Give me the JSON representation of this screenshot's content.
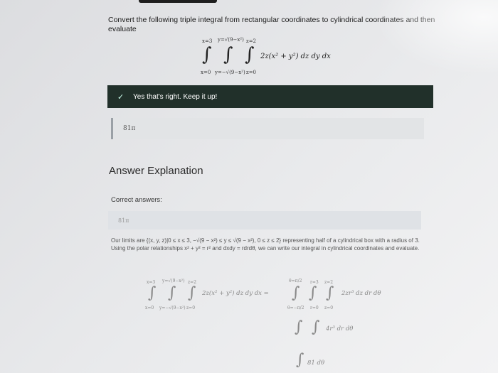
{
  "prompt": "Convert the following triple integral from rectangular coordinates to cylindrical coordinates and then evaluate",
  "question_integral": {
    "x_lower": "x=0",
    "x_upper": "x=3",
    "y_lower": "y=−√(9−x²)",
    "y_upper": "y=√(9−x²)",
    "z_lower": "z=0",
    "z_upper": "z=2",
    "integrand": "2z(x² + y²) dz dy dx"
  },
  "feedback": {
    "icon": "check-icon",
    "message": "Yes that's right. Keep it up!"
  },
  "answer_value": "81π",
  "explanation_heading": "Answer Explanation",
  "correct_answers_label": "Correct answers:",
  "correct_answer_value": "81π",
  "explanation_text": "Our limits are {(x, y, z)|0 ≤ x ≤ 3, −√(9 − x²) ≤ y ≤ √(9 − x²), 0 ≤ z ≤ 2} representing half of a cylindrical box with a radius of 3. Using the polar relationships x² + y² = r² and dxdy = rdrdθ, we can write our integral in cylindrical coordinates and evaluate.",
  "work": {
    "line1_left": "2z(x² + y²) dz dy dx =",
    "line1_right": "2zr³ dz dr dθ",
    "line2": "4r³ dr dθ",
    "line3": "81 dθ",
    "limits_left": {
      "x_upper": "x=3",
      "x_lower": "x=0",
      "y_upper": "y=√(9−x²)",
      "y_lower": "y=−√(9−x²)",
      "z_upper": "z=2",
      "z_lower": "z=0"
    },
    "limits_right": {
      "t_upper": "θ=π/2",
      "t_lower": "θ=−π/2",
      "r_upper": "r=3",
      "r_lower": "r=0",
      "z_upper": "z=2",
      "z_lower": "z=0"
    }
  }
}
